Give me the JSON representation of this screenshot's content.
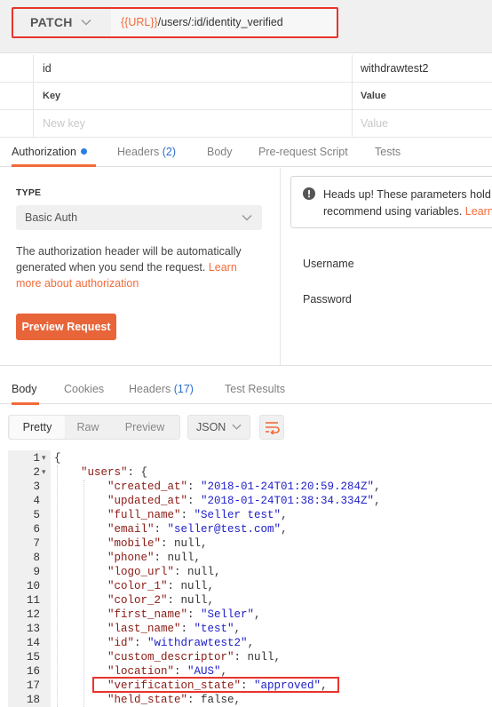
{
  "request": {
    "method": "PATCH",
    "url_var": "{{URL}}",
    "url_path": "/users/:id/identity_verified"
  },
  "params": {
    "row": {
      "key": "id",
      "value": "withdrawtest2"
    },
    "header": {
      "key": "Key",
      "value": "Value"
    },
    "placeholder": {
      "key": "New key",
      "value": "Value"
    }
  },
  "request_tabs": [
    {
      "label": "Authorization"
    },
    {
      "label": "Headers",
      "count": "(2)"
    },
    {
      "label": "Body"
    },
    {
      "label": "Pre-request Script"
    },
    {
      "label": "Tests"
    }
  ],
  "auth": {
    "type_label": "TYPE",
    "type_value": "Basic Auth",
    "desc_text": "The authorization header will be automatically generated when you send the request. ",
    "desc_link": "Learn more about authorization",
    "preview_button": "Preview Request",
    "headsup_line1": "Heads up! These parameters hold",
    "headsup_line2": "recommend using variables. ",
    "headsup_link": "Learn",
    "username_label": "Username",
    "password_label": "Password"
  },
  "response_tabs": [
    {
      "label": "Body"
    },
    {
      "label": "Cookies"
    },
    {
      "label": "Headers",
      "count": "(17)"
    },
    {
      "label": "Test Results"
    }
  ],
  "view_modes": [
    "Pretty",
    "Raw",
    "Preview"
  ],
  "format": "JSON",
  "code_lines": [
    {
      "n": "1",
      "fold": true,
      "indent": 0,
      "parts": [
        [
          "p",
          "{"
        ]
      ]
    },
    {
      "n": "2",
      "fold": true,
      "indent": 1,
      "parts": [
        [
          "k",
          "\"users\""
        ],
        [
          "p",
          ": {"
        ]
      ]
    },
    {
      "n": "3",
      "indent": 2,
      "parts": [
        [
          "k",
          "\"created_at\""
        ],
        [
          "p",
          ": "
        ],
        [
          "s",
          "\"2018-01-24T01:20:59.284Z\""
        ],
        [
          "p",
          ","
        ]
      ]
    },
    {
      "n": "4",
      "indent": 2,
      "parts": [
        [
          "k",
          "\"updated_at\""
        ],
        [
          "p",
          ": "
        ],
        [
          "s",
          "\"2018-01-24T01:38:34.334Z\""
        ],
        [
          "p",
          ","
        ]
      ]
    },
    {
      "n": "5",
      "indent": 2,
      "parts": [
        [
          "k",
          "\"full_name\""
        ],
        [
          "p",
          ": "
        ],
        [
          "s",
          "\"Seller test\""
        ],
        [
          "p",
          ","
        ]
      ]
    },
    {
      "n": "6",
      "indent": 2,
      "parts": [
        [
          "k",
          "\"email\""
        ],
        [
          "p",
          ": "
        ],
        [
          "s",
          "\"seller@test.com\""
        ],
        [
          "p",
          ","
        ]
      ]
    },
    {
      "n": "7",
      "indent": 2,
      "parts": [
        [
          "k",
          "\"mobile\""
        ],
        [
          "p",
          ": null,"
        ]
      ]
    },
    {
      "n": "8",
      "indent": 2,
      "parts": [
        [
          "k",
          "\"phone\""
        ],
        [
          "p",
          ": null,"
        ]
      ]
    },
    {
      "n": "9",
      "indent": 2,
      "parts": [
        [
          "k",
          "\"logo_url\""
        ],
        [
          "p",
          ": null,"
        ]
      ]
    },
    {
      "n": "10",
      "indent": 2,
      "parts": [
        [
          "k",
          "\"color_1\""
        ],
        [
          "p",
          ": null,"
        ]
      ]
    },
    {
      "n": "11",
      "indent": 2,
      "parts": [
        [
          "k",
          "\"color_2\""
        ],
        [
          "p",
          ": null,"
        ]
      ]
    },
    {
      "n": "12",
      "indent": 2,
      "parts": [
        [
          "k",
          "\"first_name\""
        ],
        [
          "p",
          ": "
        ],
        [
          "s",
          "\"Seller\""
        ],
        [
          "p",
          ","
        ]
      ]
    },
    {
      "n": "13",
      "indent": 2,
      "parts": [
        [
          "k",
          "\"last_name\""
        ],
        [
          "p",
          ": "
        ],
        [
          "s",
          "\"test\""
        ],
        [
          "p",
          ","
        ]
      ]
    },
    {
      "n": "14",
      "indent": 2,
      "parts": [
        [
          "k",
          "\"id\""
        ],
        [
          "p",
          ": "
        ],
        [
          "s",
          "\"withdrawtest2\""
        ],
        [
          "p",
          ","
        ]
      ]
    },
    {
      "n": "15",
      "indent": 2,
      "parts": [
        [
          "k",
          "\"custom_descriptor\""
        ],
        [
          "p",
          ": null,"
        ]
      ]
    },
    {
      "n": "16",
      "indent": 2,
      "parts": [
        [
          "k",
          "\"location\""
        ],
        [
          "p",
          ": "
        ],
        [
          "s",
          "\"AUS\""
        ],
        [
          "p",
          ","
        ]
      ]
    },
    {
      "n": "17",
      "indent": 2,
      "parts": [
        [
          "k",
          "\"verification_state\""
        ],
        [
          "p",
          ": "
        ],
        [
          "s",
          "\"approved\""
        ],
        [
          "p",
          ","
        ]
      ]
    },
    {
      "n": "18",
      "indent": 2,
      "parts": [
        [
          "k",
          "\"held_state\""
        ],
        [
          "p",
          ": false,"
        ]
      ]
    }
  ],
  "colors": {
    "accent": "#f26b3a",
    "highlight_outline": "#e8342b",
    "json_key": "#8b1a14",
    "json_string": "#2020c8",
    "info_dot": "#2a7fe0"
  }
}
